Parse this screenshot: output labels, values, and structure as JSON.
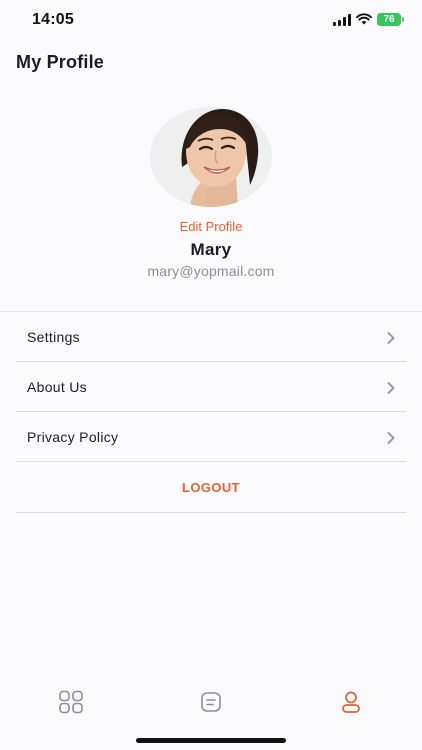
{
  "status_bar": {
    "time": "14:05",
    "battery": "76",
    "icons": [
      "signal-icon",
      "wifi-icon",
      "battery-icon"
    ]
  },
  "header": {
    "title": "My Profile"
  },
  "profile": {
    "edit_label": "Edit Profile",
    "name": "Mary",
    "email": "mary@yopmail.com"
  },
  "menu": {
    "items": [
      {
        "label": "Settings"
      },
      {
        "label": "About Us"
      },
      {
        "label": "Privacy Policy"
      }
    ],
    "logout_label": "LOGOUT"
  },
  "tab_bar": {
    "tabs": [
      {
        "icon": "grid-icon",
        "active": false
      },
      {
        "icon": "list-icon",
        "active": false
      },
      {
        "icon": "profile-icon",
        "active": true
      }
    ]
  },
  "colors": {
    "accent": "#e8602c",
    "inactive_icon": "#8e8e93",
    "text": "#1c1c28",
    "secondary_text": "#8e8e93",
    "battery": "#34c759"
  }
}
